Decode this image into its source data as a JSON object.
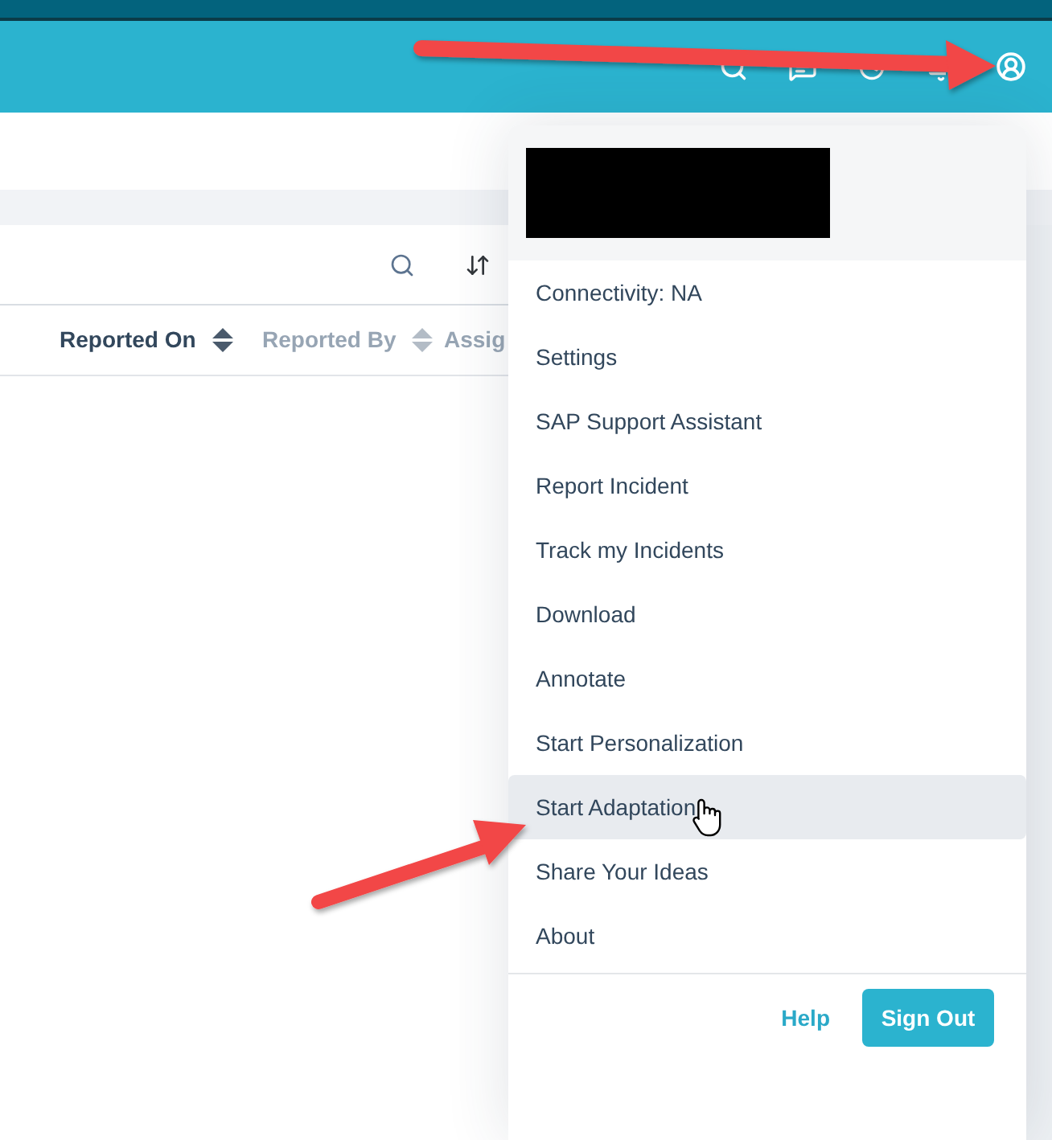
{
  "table": {
    "columns": [
      {
        "label": "Reported On",
        "sorted": true
      },
      {
        "label": "Reported By",
        "sorted": false
      },
      {
        "label": "Assig",
        "sorted": false
      }
    ]
  },
  "user_menu": {
    "items": [
      {
        "label": "Connectivity: NA",
        "hovered": false
      },
      {
        "label": "Settings",
        "hovered": false
      },
      {
        "label": "SAP Support Assistant",
        "hovered": false
      },
      {
        "label": "Report Incident",
        "hovered": false
      },
      {
        "label": "Track my Incidents",
        "hovered": false
      },
      {
        "label": "Download",
        "hovered": false
      },
      {
        "label": "Annotate",
        "hovered": false
      },
      {
        "label": "Start Personalization",
        "hovered": false
      },
      {
        "label": "Start Adaptation",
        "hovered": true
      },
      {
        "label": "Share Your Ideas",
        "hovered": false
      },
      {
        "label": "About",
        "hovered": false
      }
    ],
    "footer": {
      "help_link": "Help",
      "sign_out_button": "Sign Out"
    }
  }
}
